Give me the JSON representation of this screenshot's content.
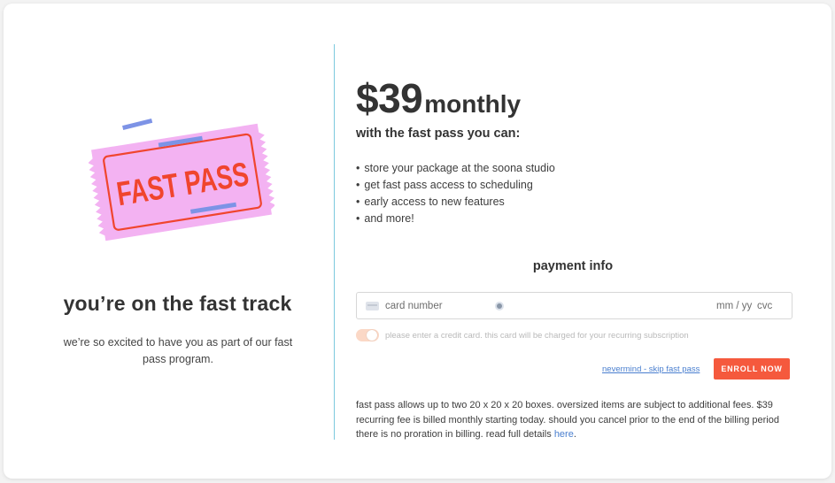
{
  "left": {
    "ticket_text": "FAST PASS",
    "title": "you’re on the fast track",
    "subtitle": "we’re so excited to have you as part of our fast pass program."
  },
  "offer": {
    "price": "$39",
    "period": "monthly",
    "with_text": "with the fast pass you can:",
    "benefits": [
      {
        "bullet": "•",
        "text": "store your package at the soona studio"
      },
      {
        "bullet": "•",
        "text": "get fast pass access to scheduling"
      },
      {
        "bullet": "•",
        "text": "early access to new features"
      },
      {
        "bullet": "•",
        "text": "and more!"
      }
    ]
  },
  "payment": {
    "title": "payment info",
    "card_number_placeholder": "card number",
    "expiry_placeholder": "mm / yy",
    "cvc_placeholder": "cvc",
    "consent_text": "please enter a credit card. this card will be charged for your recurring subscription",
    "nevermind_label": "nevermind - skip fast pass",
    "enroll_label": "ENROLL NOW"
  },
  "fine_print": {
    "text": "fast pass allows up to two 20 x 20 x 20 boxes. oversized items are subject to additional fees. $39 recurring fee is billed monthly starting today. should you cancel prior to the end of the billing period there is no proration in billing. read full details",
    "link_label": "here",
    "trailing": "."
  },
  "colors": {
    "accent": "#f5593d",
    "link": "#4a7fcf",
    "divider": "#7cc9de",
    "ticket_pink": "#f3b2f2",
    "ticket_red": "#f0452e",
    "ticket_blue": "#7d93e6"
  }
}
